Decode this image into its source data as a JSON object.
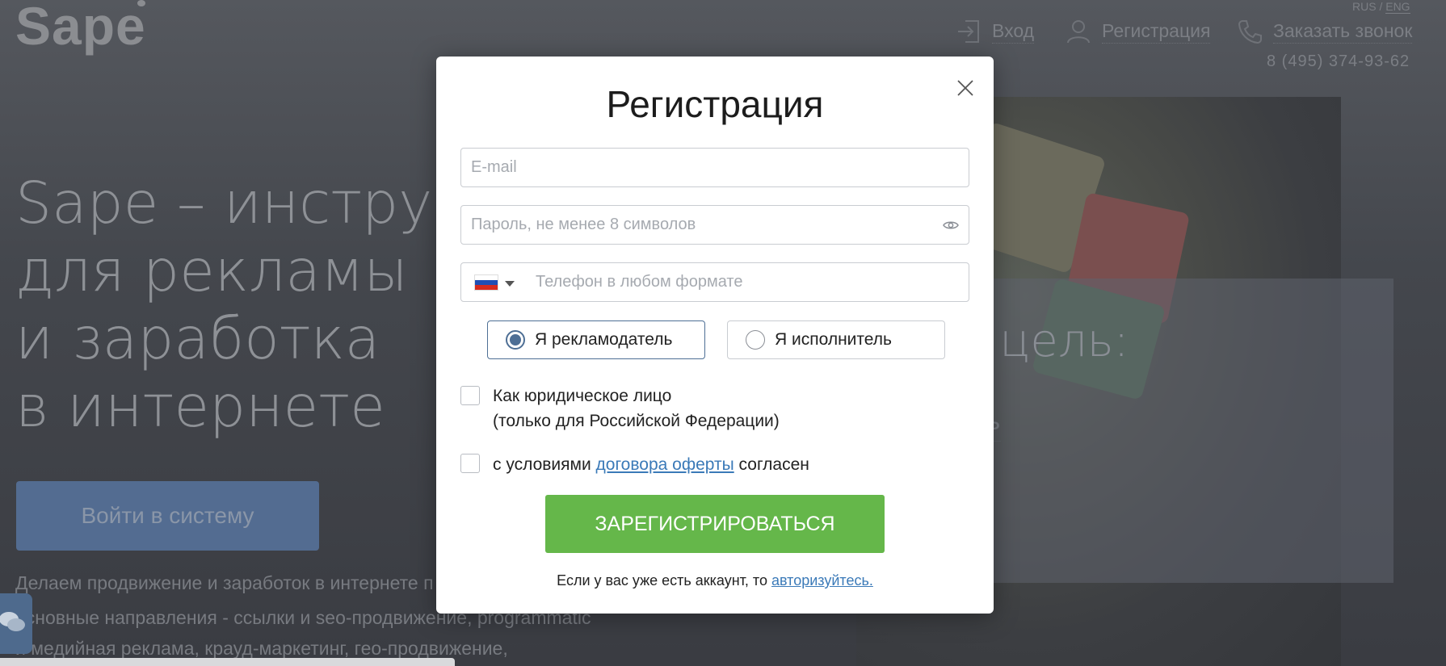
{
  "background": {
    "logo": "Sape",
    "lang": {
      "rus": "RUS",
      "separator": "/",
      "eng": "ENG"
    },
    "nav": {
      "login": "Вход",
      "register": "Регистрация",
      "callback": "Заказать звонок",
      "phone": "8 (495) 374-93-62"
    },
    "hero": {
      "line1": "Sape – инструм",
      "line2": "для рекламы",
      "line3": "и заработка",
      "line4": "в интернете"
    },
    "login_button": "Войти в систему",
    "description": {
      "line1": "Делаем продвижение и заработок в интернете п",
      "line2": "основные направления - ссылки и seo-продвижение, programmatic",
      "line3": "и медийная реклама, крауд-маркетинг, гео-продвижение,"
    },
    "goal_panel": {
      "title": "е цель:",
      "link1": "ать",
      "link2": "ть"
    },
    "icons": {
      "login": "login-arrow-icon",
      "register": "user-icon",
      "callback": "phone-icon",
      "chat": "chat-bubbles-icon"
    }
  },
  "modal": {
    "title": "Регистрация",
    "close_icon": "close-icon",
    "email_placeholder": "E-mail",
    "password_placeholder": "Пароль, не менее 8 символов",
    "password_icon": "eye-icon",
    "phone_placeholder": "Телефон в любом формате",
    "phone_country_flag": "russia-flag-icon",
    "roles": {
      "advertiser": "Я рекламодатель",
      "executor": "Я исполнитель",
      "selected": "advertiser"
    },
    "legal_entity": {
      "line1": "Как юридическое лицо",
      "line2": "(только для Российской Федерации)",
      "checked": false
    },
    "terms": {
      "prefix": "с условиями ",
      "link": "договора оферты",
      "suffix": " согласен",
      "checked": false
    },
    "submit_label": "ЗАРЕГИСТРИРОВАТЬСЯ",
    "footer": {
      "text": "Если у вас уже есть аккаунт, то ",
      "link": "авторизуйтесь."
    }
  },
  "colors": {
    "overlay_bg": "#44474d",
    "submit_green": "#65b74a",
    "radio_accent": "#4e6f95",
    "link_blue": "#3b7ab8",
    "login_button_blue": "#536c91"
  }
}
